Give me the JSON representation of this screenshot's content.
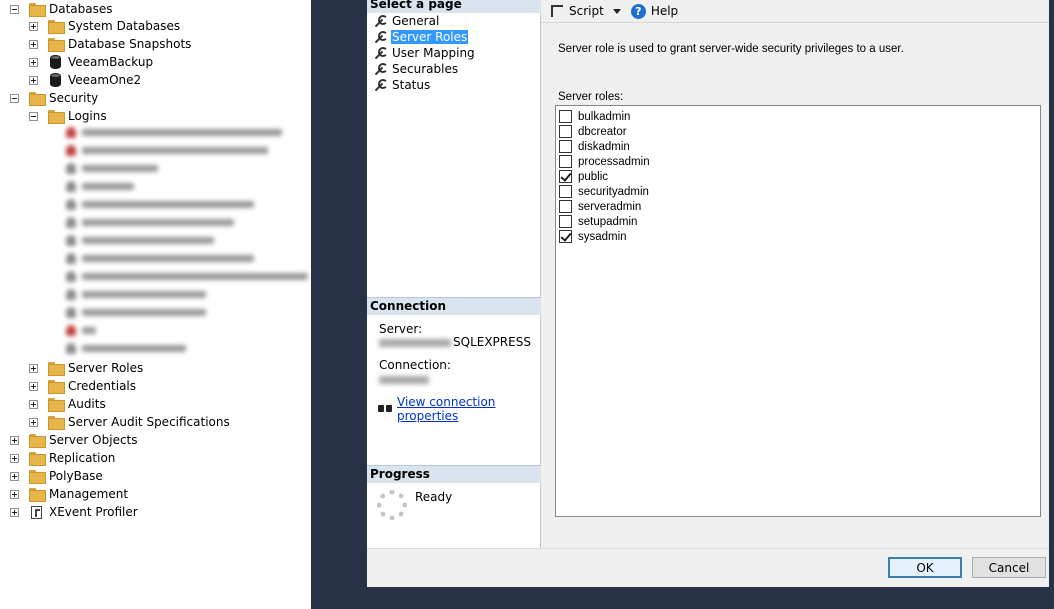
{
  "tree": {
    "nodes": [
      {
        "label": "Databases",
        "expanded": true,
        "icon": "folder-icon"
      },
      {
        "label": "System Databases",
        "icon": "folder-icon"
      },
      {
        "label": "Database Snapshots",
        "icon": "folder-icon"
      },
      {
        "label": "VeeamBackup",
        "icon": "database-icon"
      },
      {
        "label": "VeeamOne2",
        "icon": "database-icon"
      },
      {
        "label": "Security",
        "expanded": true,
        "icon": "folder-icon"
      },
      {
        "label": "Logins",
        "expanded": true,
        "icon": "folder-icon"
      },
      {
        "label": "Server Roles",
        "icon": "folder-icon"
      },
      {
        "label": "Credentials",
        "icon": "folder-icon"
      },
      {
        "label": "Audits",
        "icon": "folder-icon"
      },
      {
        "label": "Server Audit Specifications",
        "icon": "folder-icon"
      },
      {
        "label": "Server Objects",
        "icon": "folder-icon"
      },
      {
        "label": "Replication",
        "icon": "folder-icon"
      },
      {
        "label": "PolyBase",
        "icon": "folder-icon"
      },
      {
        "label": "Management",
        "icon": "folder-icon"
      },
      {
        "label": "XEvent Profiler",
        "icon": "xevent-profiler-icon"
      }
    ]
  },
  "dialog": {
    "select_page_header": "Select a page",
    "pages": [
      "General",
      "Server Roles",
      "User Mapping",
      "Securables",
      "Status"
    ],
    "selected_page": "Server Roles",
    "connection_header": "Connection",
    "server_label": "Server:",
    "server_value_suffix": "SQLEXPRESS",
    "connection_label": "Connection:",
    "view_connection_link": "View connection properties",
    "progress_header": "Progress",
    "progress_status": "Ready",
    "toolbar": {
      "script_label": "Script",
      "help_label": "Help"
    },
    "description": "Server role is used to grant server-wide security privileges to a user.",
    "roles_caption": "Server roles:",
    "roles": [
      {
        "name": "bulkadmin",
        "checked": false
      },
      {
        "name": "dbcreator",
        "checked": false
      },
      {
        "name": "diskadmin",
        "checked": false
      },
      {
        "name": "processadmin",
        "checked": false
      },
      {
        "name": "public",
        "checked": true
      },
      {
        "name": "securityadmin",
        "checked": false
      },
      {
        "name": "serveradmin",
        "checked": false
      },
      {
        "name": "setupadmin",
        "checked": false
      },
      {
        "name": "sysadmin",
        "checked": true
      }
    ],
    "ok_label": "OK",
    "cancel_label": "Cancel"
  }
}
